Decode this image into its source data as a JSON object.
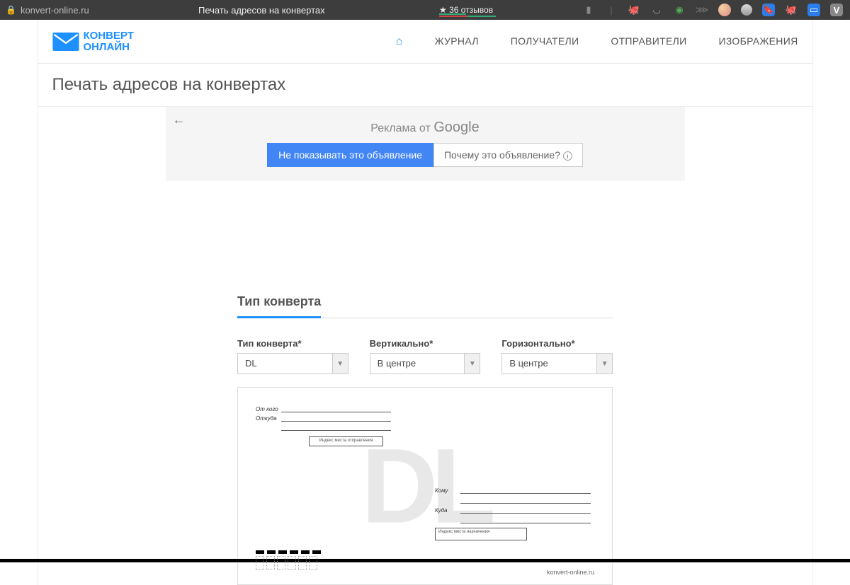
{
  "browser": {
    "url": "konvert-online.ru",
    "tab_title": "Печать адресов на конвертах",
    "reviews": "★ 36 отзывов"
  },
  "logo": {
    "line1": "КОНВЕРТ",
    "line2": "ОНЛАЙН"
  },
  "nav": {
    "journal": "ЖУРНАЛ",
    "recipients": "ПОЛУЧАТЕЛИ",
    "senders": "ОТПРАВИТЕЛИ",
    "images": "ИЗОБРАЖЕНИЯ"
  },
  "page_title": "Печать адресов на конвертах",
  "ad": {
    "prefix": "Реклама от ",
    "brand": "Google",
    "hide_btn": "Не показывать это объявление",
    "why_btn": "Почему это объявление?"
  },
  "form": {
    "section_title": "Тип конверта",
    "type_label": "Тип конверта*",
    "type_value": "DL",
    "vert_label": "Вертикально*",
    "vert_value": "В центре",
    "horiz_label": "Горизонтально*",
    "horiz_value": "В центре"
  },
  "envelope": {
    "watermark": "DL",
    "from_label": "От кого",
    "from_where": "Откуда",
    "index_send": "Индекс места отправления",
    "to_label": "Кому",
    "to_where": "Куда",
    "index_recv": "Индекс места назначения",
    "site": "konvert-online.ru"
  }
}
